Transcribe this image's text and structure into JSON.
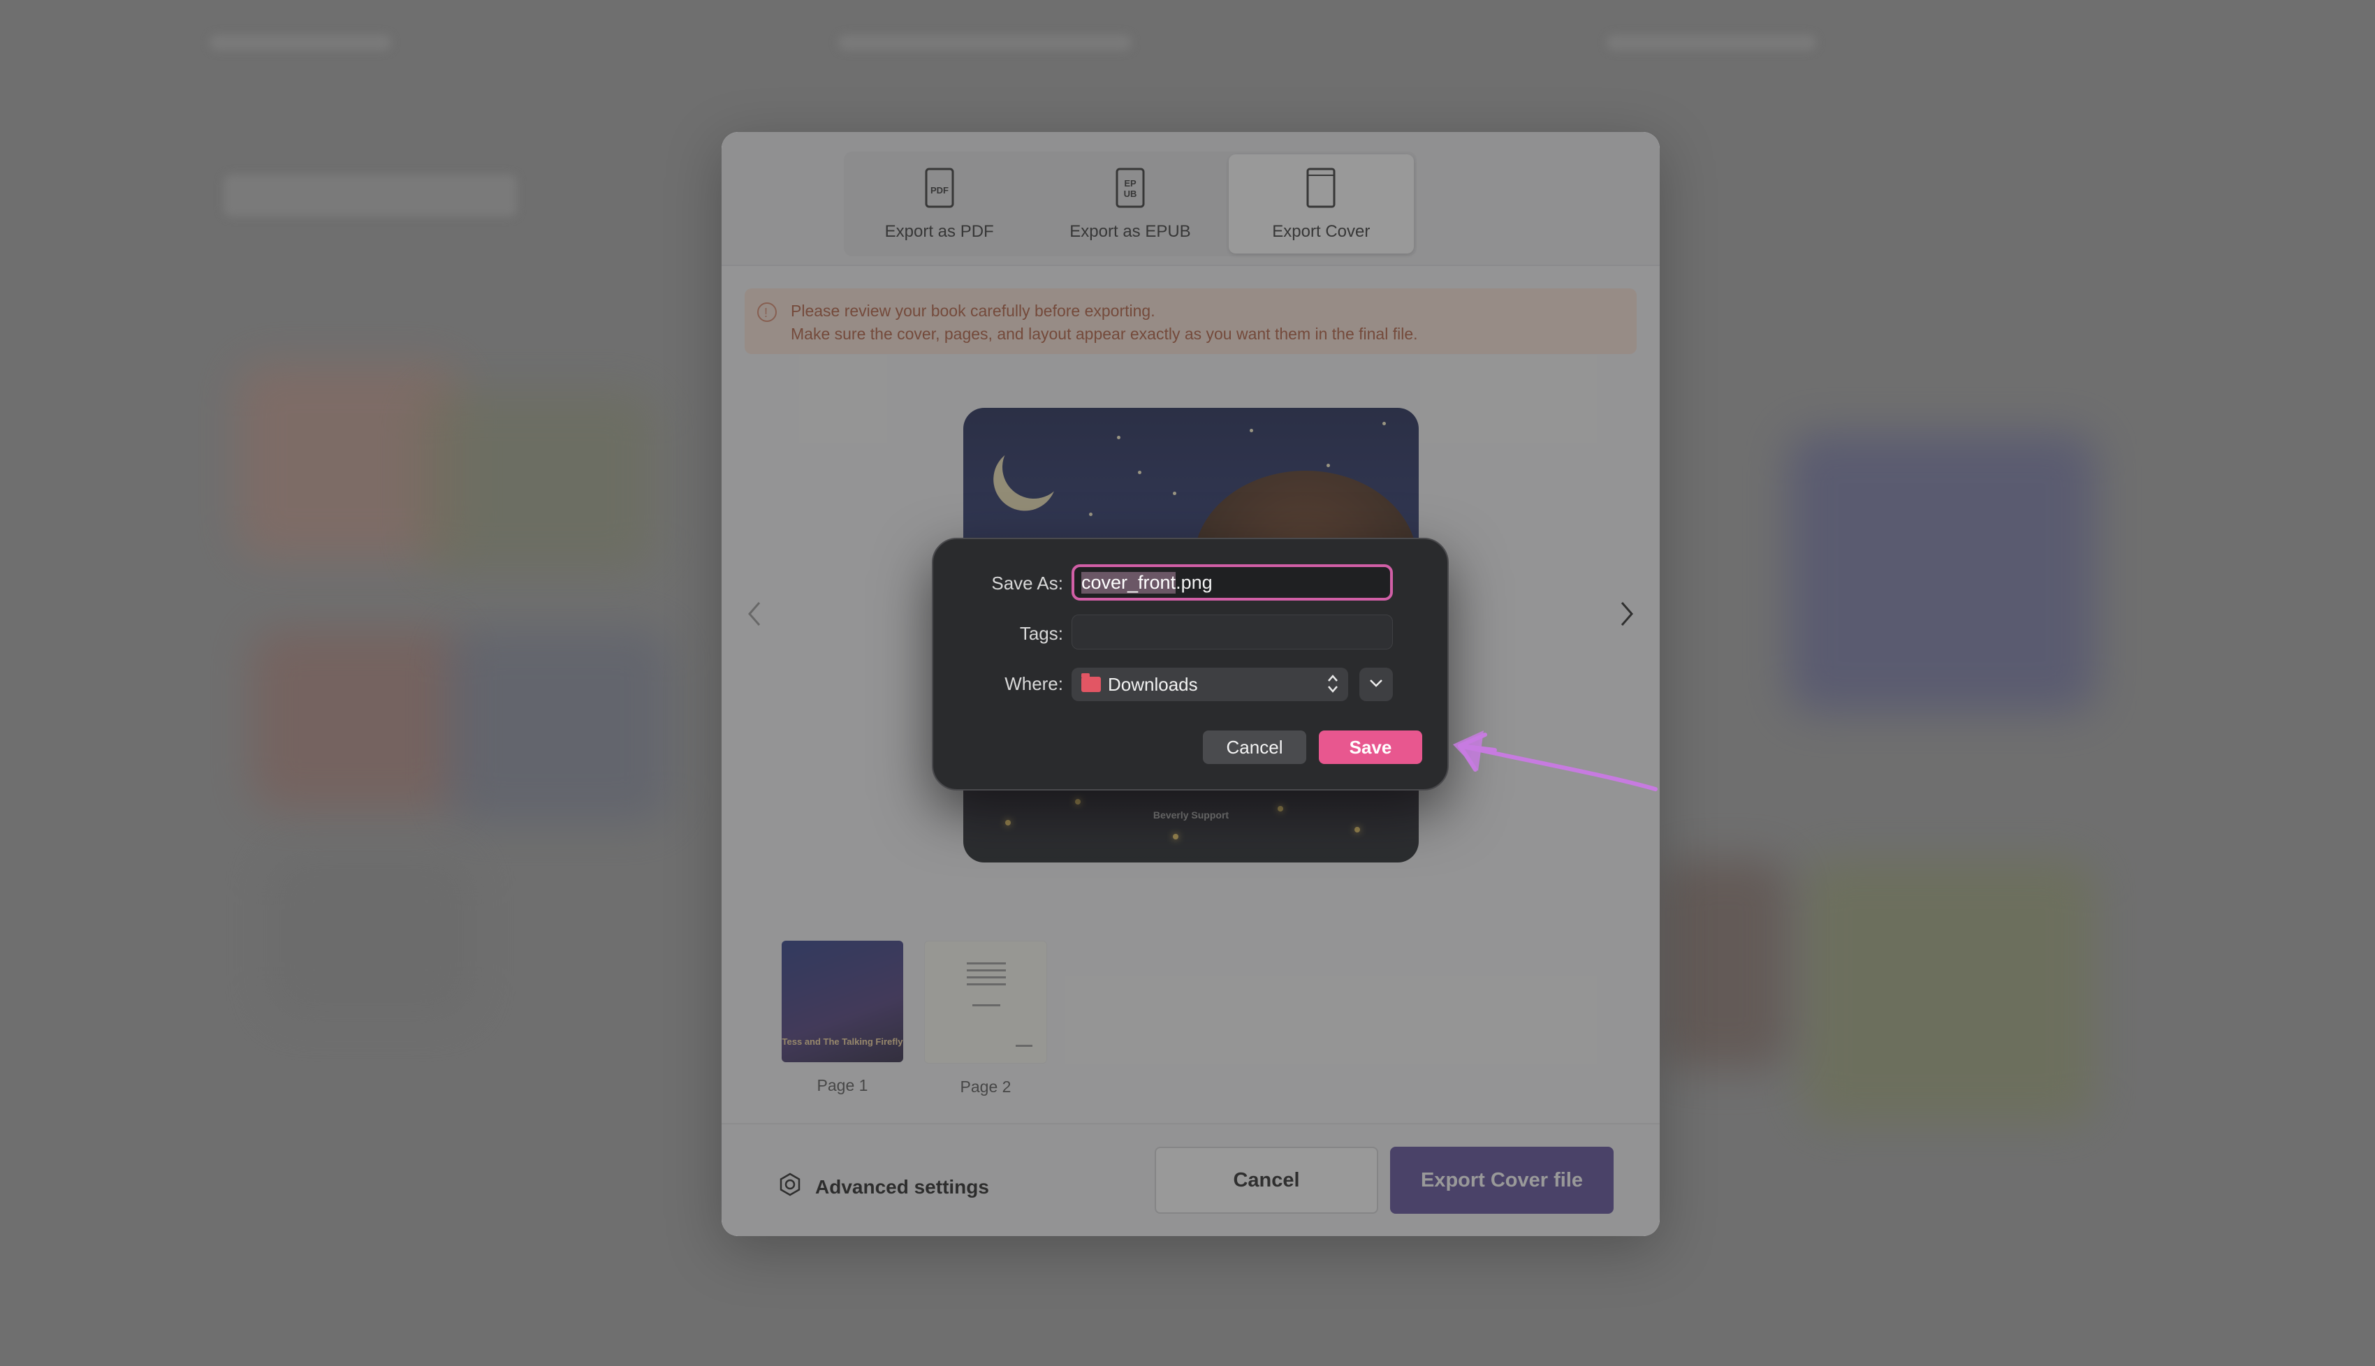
{
  "export_modal": {
    "tabs": [
      {
        "label": "Export as PDF",
        "icon": "pdf-file-icon"
      },
      {
        "label": "Export as EPUB",
        "icon": "epub-file-icon"
      },
      {
        "label": "Export Cover",
        "icon": "book-cover-icon",
        "active": true
      }
    ],
    "alert": {
      "line1": "Please review your book carefully before exporting.",
      "line2": "Make sure the cover, pages, and layout appear exactly as you want them in the final file.",
      "icon": "info-icon",
      "color": "#b25a3c"
    },
    "preview": {
      "author_text": "Beverly Support"
    },
    "thumbnails": [
      {
        "label": "Page 1",
        "title_text": "Tess and The Talking Firefly"
      },
      {
        "label": "Page 2"
      }
    ],
    "footer": {
      "advanced_label": "Advanced settings",
      "cancel_label": "Cancel",
      "export_label": "Export Cover file",
      "export_color": "#5b4a9a"
    }
  },
  "save_dialog": {
    "save_as_label": "Save As:",
    "filename_selected": "cover_front",
    "filename_ext": ".png",
    "tags_label": "Tags:",
    "tags_value": "",
    "where_label": "Where:",
    "where_value": "Downloads",
    "cancel_label": "Cancel",
    "save_label": "Save",
    "save_color": "#e8578f",
    "focus_color": "#d15fa6"
  },
  "annotation": {
    "type": "arrow",
    "color": "#c77be0",
    "points_to": "save-dialog-save-button"
  }
}
